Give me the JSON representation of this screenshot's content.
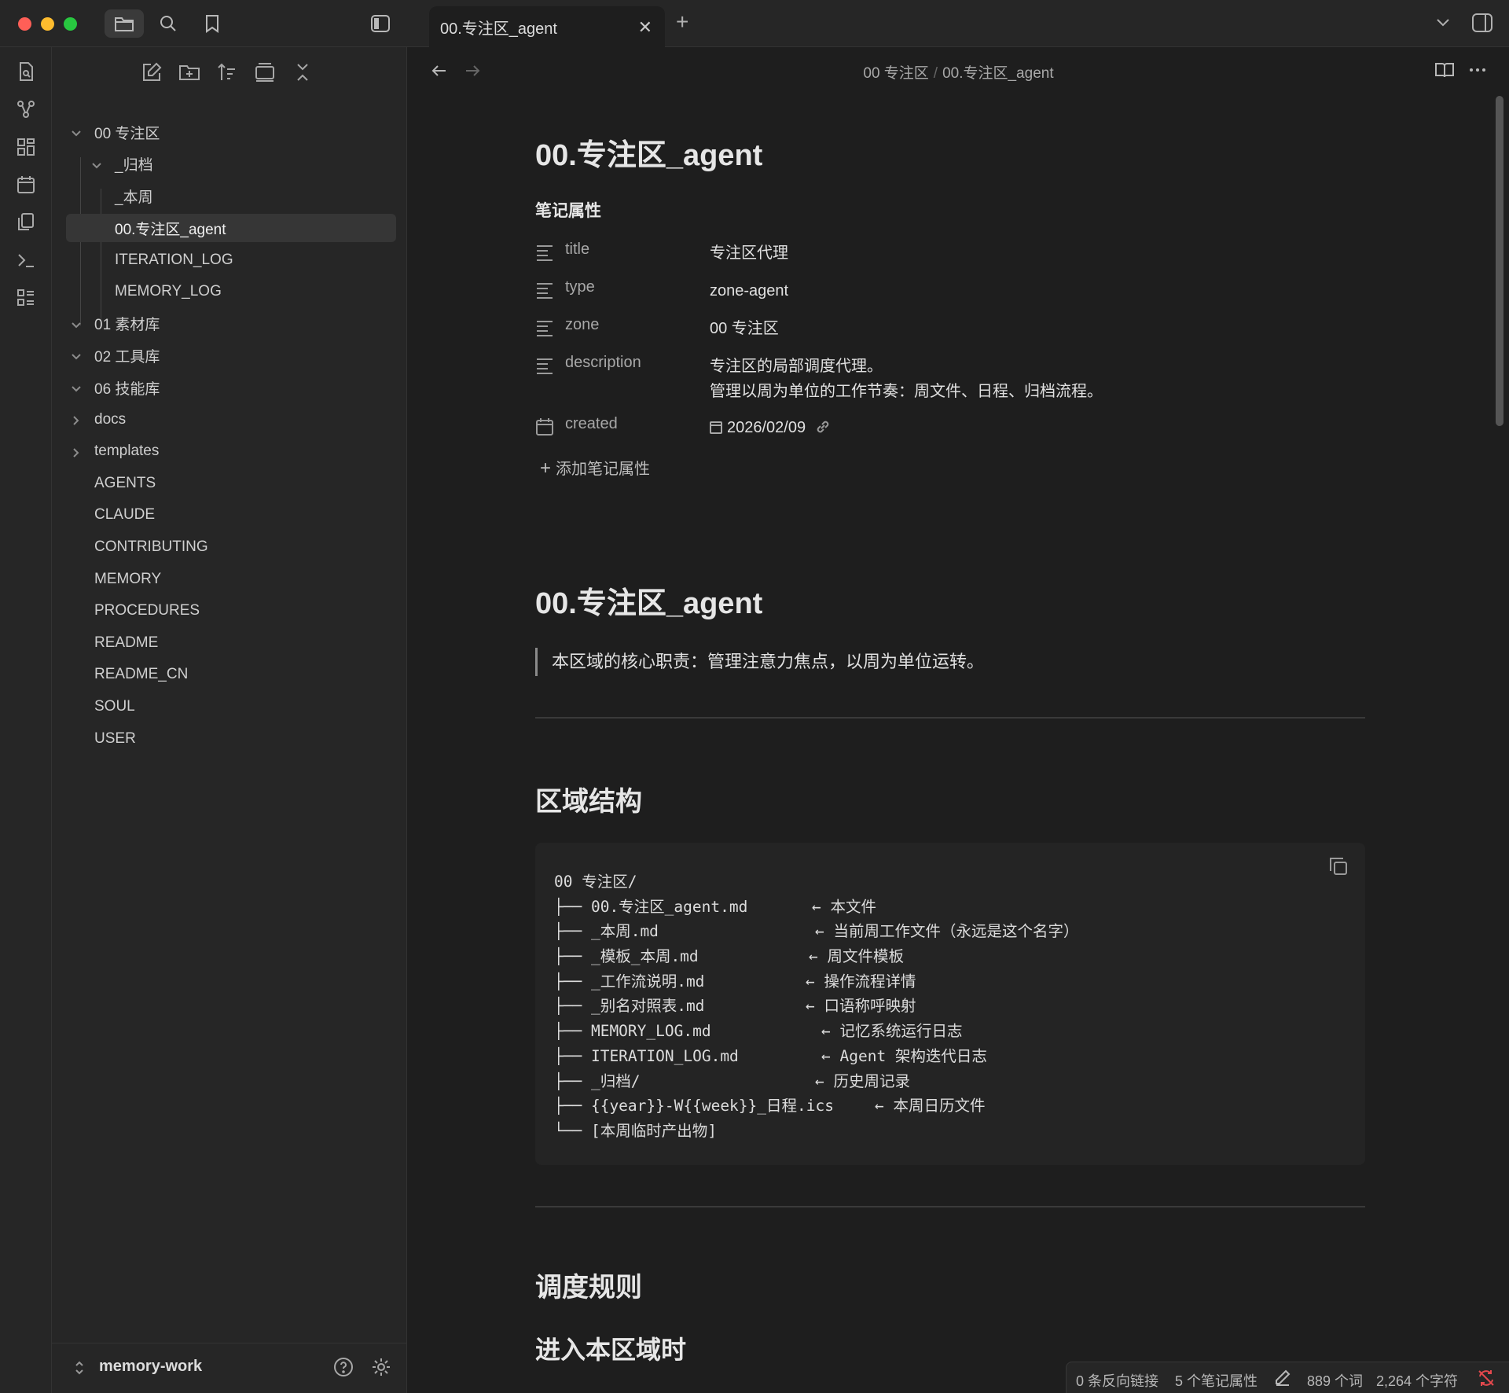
{
  "tab": {
    "title": "00.专注区_agent"
  },
  "breadcrumb": {
    "parent": "00 专注区",
    "separator": "/",
    "current": "00.专注区_agent"
  },
  "sidebar": {
    "tree": [
      {
        "label": "00 专注区",
        "level": 0,
        "chevron": "down"
      },
      {
        "label": "_归档",
        "level": 1,
        "chevron": "down"
      },
      {
        "label": "_本周",
        "level": 2,
        "chevron": ""
      },
      {
        "label": "00.专注区_agent",
        "level": 2,
        "chevron": "",
        "selected": true
      },
      {
        "label": "ITERATION_LOG",
        "level": 2,
        "chevron": ""
      },
      {
        "label": "MEMORY_LOG",
        "level": 2,
        "chevron": ""
      },
      {
        "label": "01 素材库",
        "level": 0,
        "chevron": "down"
      },
      {
        "label": "02 工具库",
        "level": 0,
        "chevron": "down"
      },
      {
        "label": "06 技能库",
        "level": 0,
        "chevron": "down"
      },
      {
        "label": "docs",
        "level": 0,
        "chevron": "right"
      },
      {
        "label": "templates",
        "level": 0,
        "chevron": "right"
      },
      {
        "label": "AGENTS",
        "level": 0,
        "chevron": ""
      },
      {
        "label": "CLAUDE",
        "level": 0,
        "chevron": ""
      },
      {
        "label": "CONTRIBUTING",
        "level": 0,
        "chevron": ""
      },
      {
        "label": "MEMORY",
        "level": 0,
        "chevron": ""
      },
      {
        "label": "PROCEDURES",
        "level": 0,
        "chevron": ""
      },
      {
        "label": "README",
        "level": 0,
        "chevron": ""
      },
      {
        "label": "README_CN",
        "level": 0,
        "chevron": ""
      },
      {
        "label": "SOUL",
        "level": 0,
        "chevron": ""
      },
      {
        "label": "USER",
        "level": 0,
        "chevron": ""
      }
    ],
    "vault_name": "memory-work"
  },
  "doc": {
    "title": "00.专注区_agent",
    "properties_heading": "笔记属性",
    "properties": [
      {
        "key": "title",
        "value": "专注区代理",
        "icon": "text-lines-icon"
      },
      {
        "key": "type",
        "value": "zone-agent",
        "icon": "text-lines-icon"
      },
      {
        "key": "zone",
        "value": "00 专注区",
        "icon": "text-lines-icon"
      },
      {
        "key": "description",
        "value": "专注区的局部调度代理。",
        "value2": "管理以周为单位的工作节奏：周文件、日程、归档流程。",
        "icon": "text-lines-icon"
      },
      {
        "key": "created",
        "value": "2026/02/09",
        "icon": "calendar-icon"
      }
    ],
    "add_property": "添加笔记属性",
    "h1": "00.专注区_agent",
    "quote": "本区域的核心职责：管理注意力焦点，以周为单位运转。",
    "section1": "区域结构",
    "code": {
      "lines": [
        {
          "path": "00 专注区/",
          "comment": ""
        },
        {
          "path": "├── 00.专注区_agent.md",
          "comment": "← 本文件"
        },
        {
          "path": "├── _本周.md",
          "comment": "← 当前周工作文件（永远是这个名字）"
        },
        {
          "path": "├── _模板_本周.md",
          "comment": "← 周文件模板"
        },
        {
          "path": "├── _工作流说明.md",
          "comment": "← 操作流程详情"
        },
        {
          "path": "├── _别名对照表.md",
          "comment": "← 口语称呼映射"
        },
        {
          "path": "├── MEMORY_LOG.md",
          "comment": "← 记忆系统运行日志"
        },
        {
          "path": "├── ITERATION_LOG.md",
          "comment": "← Agent 架构迭代日志"
        },
        {
          "path": "├── _归档/",
          "comment": "← 历史周记录"
        },
        {
          "path": "├── {{year}}-W{{week}}_日程.ics",
          "comment": "← 本周日历文件"
        },
        {
          "path": "└── [本周临时产出物]",
          "comment": ""
        }
      ]
    },
    "section2": "调度规则",
    "section3": "进入本区域时"
  },
  "status": {
    "backlinks": "0 条反向链接",
    "properties": "5 个笔记属性",
    "words": "889 个词",
    "chars": "2,264 个字符"
  },
  "colors": {
    "accent_sync_error": "#e5484d",
    "background": "#1e1e1e",
    "sidebar": "#262626"
  }
}
